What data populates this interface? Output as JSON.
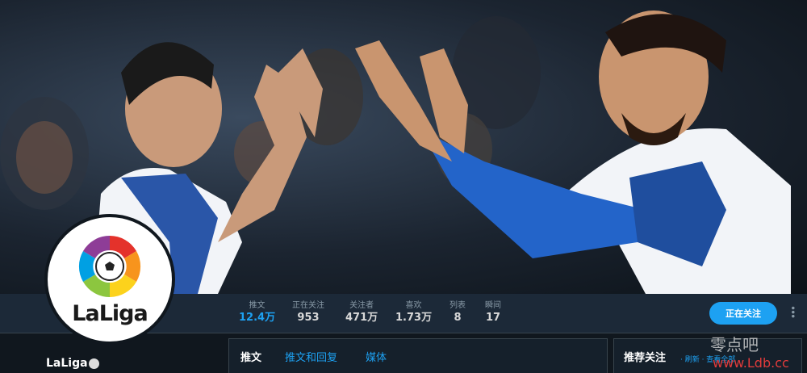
{
  "profile": {
    "name": "LaLiga",
    "avatar_text": "LaLiga"
  },
  "stats": [
    {
      "label": "推文",
      "value": "12.4万"
    },
    {
      "label": "正在关注",
      "value": "953"
    },
    {
      "label": "关注者",
      "value": "471万"
    },
    {
      "label": "喜欢",
      "value": "1.73万"
    },
    {
      "label": "列表",
      "value": "8"
    },
    {
      "label": "瞬间",
      "value": "17"
    }
  ],
  "actions": {
    "follow_label": "正在关注",
    "more": "•••"
  },
  "tabs": [
    {
      "label": "推文"
    },
    {
      "label": "推文和回复"
    },
    {
      "label": "媒体"
    }
  ],
  "sidebar": {
    "title": "推荐关注",
    "links": "· 刷新 · 查看全部"
  },
  "watermark": {
    "cn": "零点吧",
    "url": "www.Ldb.cc"
  },
  "colors": {
    "accent": "#1da1f2",
    "background": "#10171e",
    "navbar": "#1c2938"
  }
}
